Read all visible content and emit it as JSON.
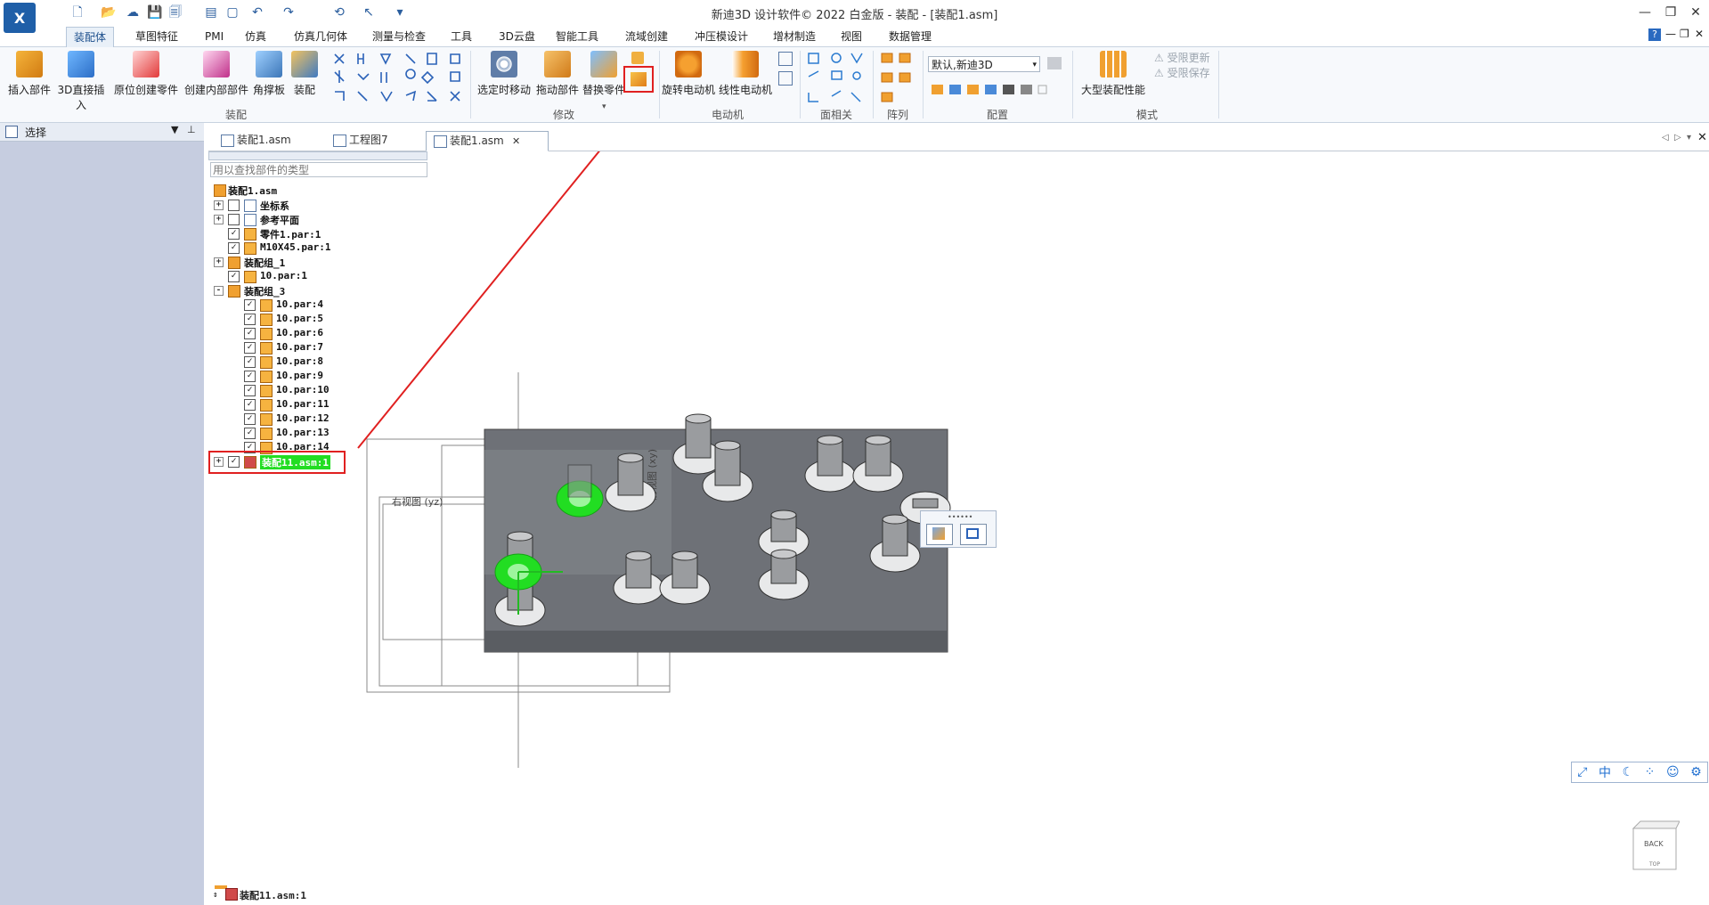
{
  "title_bar": {
    "logo_text": "X",
    "window_title": "新迪3D 设计软件© 2022 白金版 - 装配 - [装配1.asm]"
  },
  "ribbon_tabs": [
    "装配体",
    "草图特征",
    "PMI",
    "仿真",
    "仿真几何体",
    "测量与检查",
    "工具",
    "3D云盘",
    "智能工具",
    "流域创建",
    "冲压模设计",
    "增材制造",
    "视图",
    "数据管理"
  ],
  "ribbon": {
    "assembly_buttons": [
      "插入部件",
      "3D直接插入",
      "原位创建零件",
      "创建内部部件",
      "角撑板",
      "装配"
    ],
    "assembly_group": "装配",
    "modify_buttons": [
      "选定时移动",
      "拖动部件",
      "替换零件"
    ],
    "modify_group": "修改",
    "motor_buttons": [
      "旋转电动机",
      "线性电动机"
    ],
    "motor_group": "电动机",
    "face_group": "面相关",
    "array_group": "阵列",
    "config_select": "默认,新迪3D",
    "config_group": "配置",
    "large_assembly_label": "大型装配性能",
    "limited_update": "受限更新",
    "limited_save": "受限保存",
    "mode_group": "模式"
  },
  "left_panel": {
    "title": "选择"
  },
  "doc_tabs": [
    "装配1.asm",
    "工程图7",
    "装配1.asm"
  ],
  "tree": {
    "filter_placeholder": "用以查找部件的类型",
    "root": "装配1.asm",
    "rows": [
      {
        "label": "坐标系",
        "checked": false,
        "expander": "+"
      },
      {
        "label": "参考平面",
        "checked": false,
        "expander": "+"
      },
      {
        "label": "零件1.par:1",
        "checked": true,
        "expander": ""
      },
      {
        "label": "M10X45.par:1",
        "checked": true,
        "expander": ""
      },
      {
        "label": "装配组_1",
        "checked": null,
        "expander": "+"
      },
      {
        "label": "10.par:1",
        "checked": true,
        "expander": ""
      },
      {
        "label": "装配组_3",
        "checked": null,
        "expander": "-"
      },
      {
        "label": "10.par:4",
        "checked": true,
        "expander": ""
      },
      {
        "label": "10.par:5",
        "checked": true,
        "expander": ""
      },
      {
        "label": "10.par:6",
        "checked": true,
        "expander": ""
      },
      {
        "label": "10.par:7",
        "checked": true,
        "expander": ""
      },
      {
        "label": "10.par:8",
        "checked": true,
        "expander": ""
      },
      {
        "label": "10.par:9",
        "checked": true,
        "expander": ""
      },
      {
        "label": "10.par:10",
        "checked": true,
        "expander": ""
      },
      {
        "label": "10.par:11",
        "checked": true,
        "expander": ""
      },
      {
        "label": "10.par:12",
        "checked": true,
        "expander": ""
      },
      {
        "label": "10.par:13",
        "checked": true,
        "expander": ""
      },
      {
        "label": "10.par:14",
        "checked": true,
        "expander": ""
      },
      {
        "label": "装配11.asm:1",
        "checked": true,
        "expander": "+"
      }
    ],
    "selected_label": "装配11.asm:1"
  },
  "viewport": {
    "plane_label_yz": "右视图 (yz)",
    "plane_label_xy": "前视图 (xy)",
    "viewcube_top": "BACK",
    "viewcube_bottom": "TOP"
  },
  "view_toolbar": [
    "中"
  ],
  "status": {
    "selected_item": "装配11.asm:1"
  },
  "colors": {
    "accent": "#1d4f8c",
    "highlight": "#22dd22",
    "annotation": "#e02020",
    "plate": "#6f7278"
  }
}
